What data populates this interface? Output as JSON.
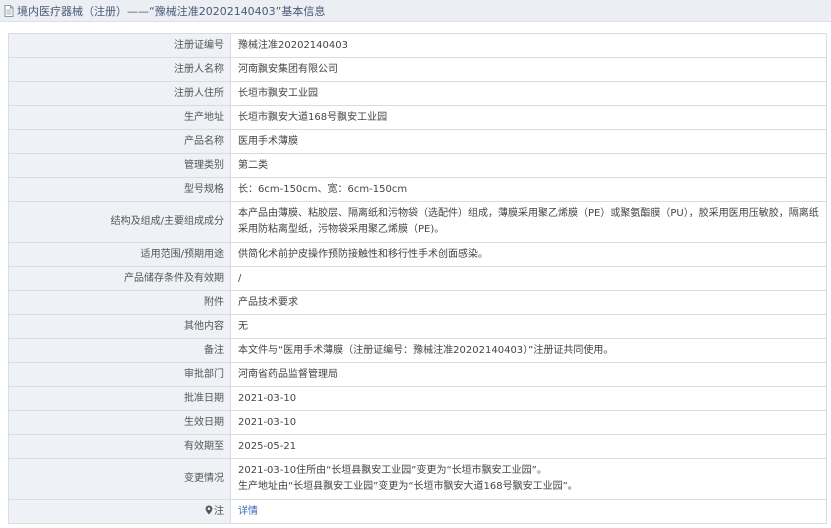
{
  "header": {
    "title": "境内医疗器械（注册）——“豫械注准20202140403”基本信息"
  },
  "rows": [
    {
      "label": "注册证编号",
      "value": "豫械注准20202140403"
    },
    {
      "label": "注册人名称",
      "value": "河南飘安集团有限公司"
    },
    {
      "label": "注册人住所",
      "value": "长垣市飘安工业园"
    },
    {
      "label": "生产地址",
      "value": "长垣市飘安大道168号飘安工业园"
    },
    {
      "label": "产品名称",
      "value": "医用手术薄膜"
    },
    {
      "label": "管理类别",
      "value": "第二类"
    },
    {
      "label": "型号规格",
      "value": "长：6cm-150cm、宽：6cm-150cm"
    },
    {
      "label": "结构及组成/主要组成成分",
      "value": "本产品由薄膜、粘胶层、隔离纸和污物袋（选配件）组成，薄膜采用聚乙烯膜（PE）或聚氨酯膜（PU），胶采用医用压敏胶，隔离纸采用防粘离型纸，污物袋采用聚乙烯膜（PE)。"
    },
    {
      "label": "适用范围/预期用途",
      "value": "供简化术前护皮操作预防接触性和移行性手术创面感染。"
    },
    {
      "label": "产品储存条件及有效期",
      "value": "/"
    },
    {
      "label": "附件",
      "value": "产品技术要求"
    },
    {
      "label": "其他内容",
      "value": "无"
    },
    {
      "label": "备注",
      "value": "本文件与“医用手术薄膜（注册证编号：豫械注准20202140403）”注册证共同使用。"
    },
    {
      "label": "审批部门",
      "value": "河南省药品监督管理局"
    },
    {
      "label": "批准日期",
      "value": "2021-03-10"
    },
    {
      "label": "生效日期",
      "value": "2021-03-10"
    },
    {
      "label": "有效期至",
      "value": "2025-05-21"
    },
    {
      "label": "变更情况",
      "value_line1": "2021-03-10住所由“长垣县飘安工业园”变更为“长垣市飘安工业园”。",
      "value_line2": "生产地址由“长垣县飘安工业园”变更为“长垣市飘安大道168号飘安工业园”。"
    },
    {
      "label": "注",
      "value": "详情"
    }
  ],
  "icons": {
    "header_icon": "document-icon",
    "note_icon": "location-pin-icon"
  }
}
